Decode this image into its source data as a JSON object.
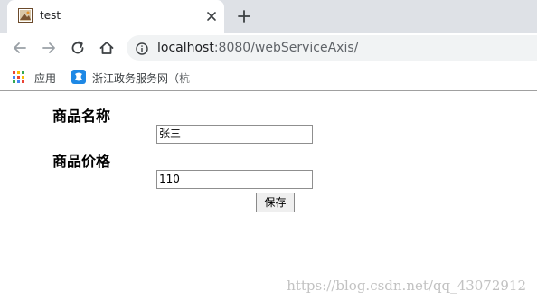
{
  "tab": {
    "title": "test",
    "favicon": "page-image-icon"
  },
  "toolbar": {
    "back_icon": "arrow-left-icon",
    "forward_icon": "arrow-right-icon",
    "reload_icon": "reload-icon",
    "home_icon": "home-icon",
    "info_icon": "info-icon",
    "url_host": "localhost",
    "url_path": ":8080/webServiceAxis/"
  },
  "bookmarks": [
    {
      "label": "应用",
      "icon": "apps-grid-icon"
    },
    {
      "label": "浙江政务服务网（杭",
      "icon": "zhejiang-gov-icon"
    }
  ],
  "form": {
    "name_label": "商品名称",
    "name_value": "张三",
    "price_label": "商品价格",
    "price_value": "110",
    "save_label": "保存"
  },
  "watermark": "https://blog.csdn.net/qq_43072912",
  "colors": {
    "tabstrip": "#dee1e6",
    "omnibox": "#f1f3f4",
    "apps_grid": [
      "#ea4335",
      "#fbbc05",
      "#34a853",
      "#4285f4"
    ],
    "gov_icon": "#1e88e5"
  }
}
